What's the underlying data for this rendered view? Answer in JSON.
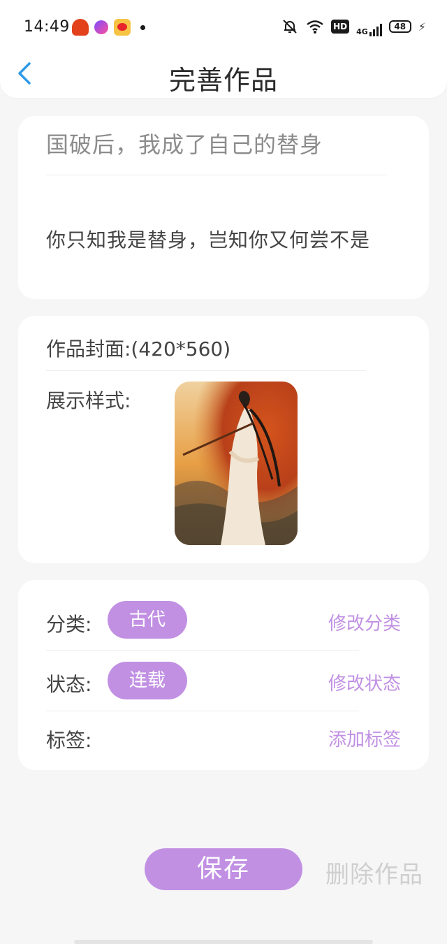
{
  "status_bar": {
    "time": "14:49",
    "hd": "HD",
    "network": "4G",
    "battery": "48"
  },
  "header": {
    "title": "完善作品"
  },
  "work": {
    "title": "国破后，我成了自己的替身",
    "description": "你只知我是替身，岂知你又何尝不是"
  },
  "cover": {
    "label": "作品封面:(420*560)",
    "display_label": "展示样式:"
  },
  "meta": {
    "category_label": "分类:",
    "category_value": "古代",
    "category_action": "修改分类",
    "status_label": "状态:",
    "status_value": "连载",
    "status_action": "修改状态",
    "tags_label": "标签:",
    "tags_action": "添加标签"
  },
  "actions": {
    "save": "保存",
    "delete": "删除作品"
  },
  "colors": {
    "accent": "#c190e3",
    "back_arrow": "#2f9ae8",
    "disabled": "#cfcfcf"
  }
}
